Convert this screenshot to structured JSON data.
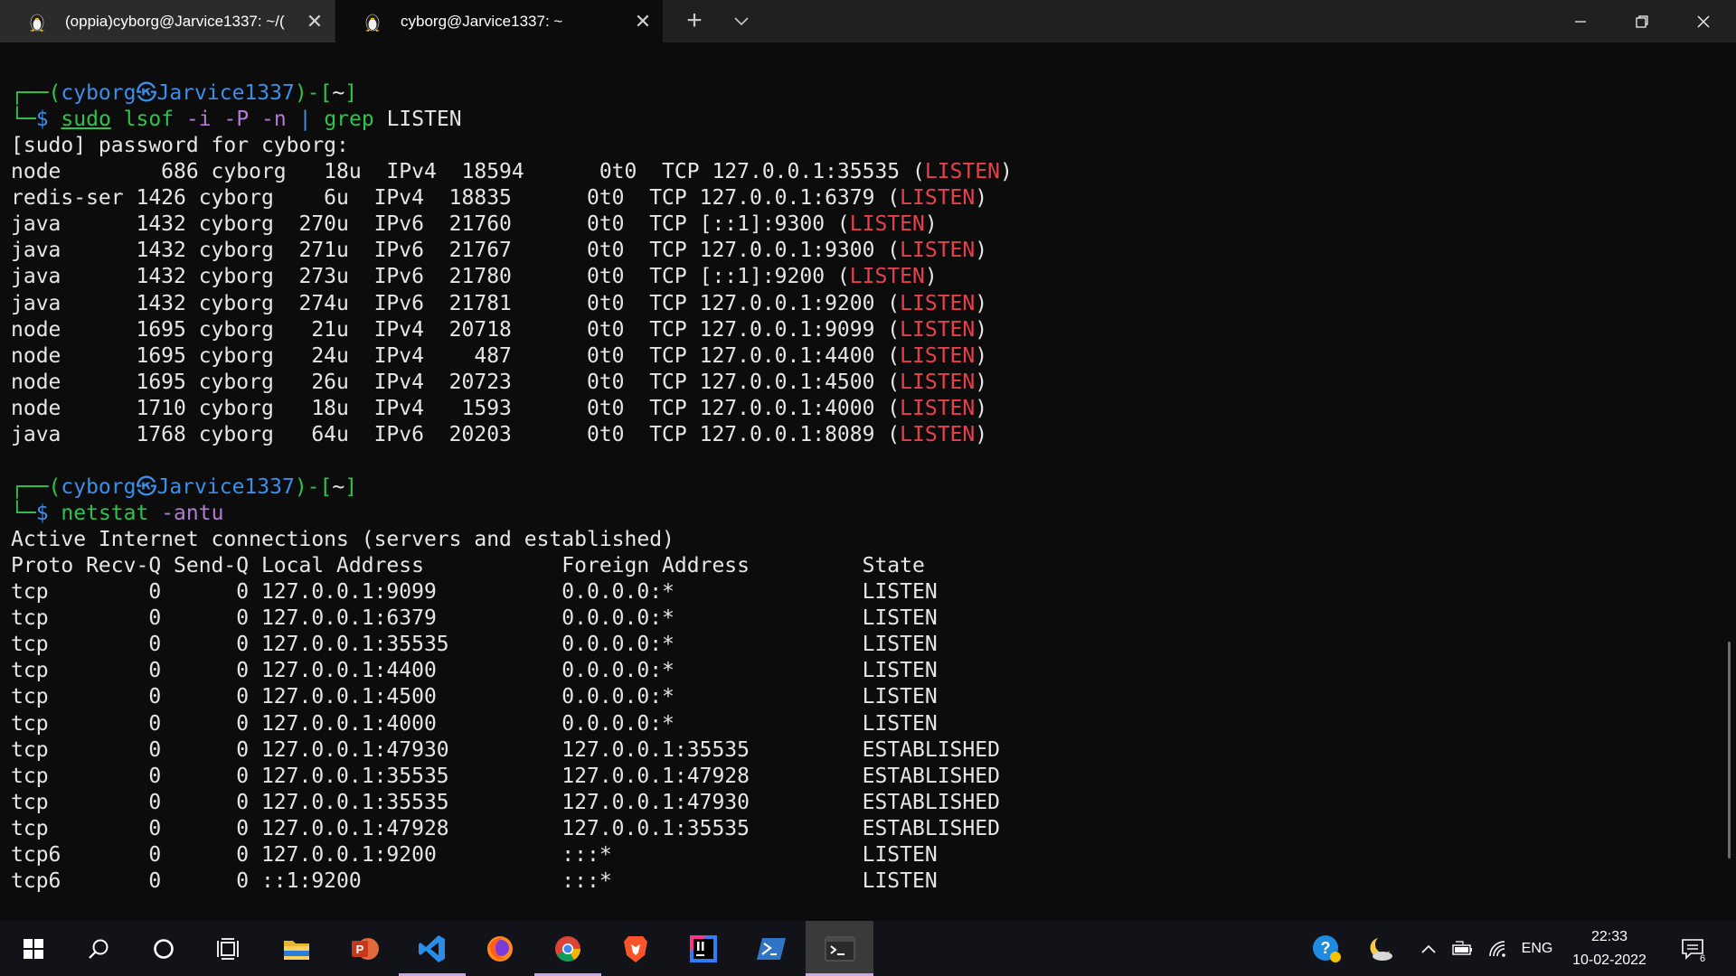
{
  "window": {
    "tabs": [
      {
        "title": "(oppia)cyborg@Jarvice1337: ~/(",
        "icon": "tux-icon",
        "active": false
      },
      {
        "title": "cyborg@Jarvice1337: ~",
        "icon": "tux-icon",
        "active": true
      }
    ],
    "close_glyph": "✕",
    "new_tab_glyph": "+"
  },
  "terminal": {
    "prompt1": {
      "user": "cyborg",
      "at": "㉿",
      "host": "Jarvice1337",
      "dir": "~"
    },
    "command1": {
      "p1": "sudo",
      "p2": "lsof",
      "p3": "-i",
      "p4": "-P",
      "p5": "-n",
      "pipe": "|",
      "p6": "grep",
      "p7": "LISTEN"
    },
    "sudo_prompt": "[sudo] password for cyborg:",
    "lsof_rows": [
      {
        "pre": "node        686 cyborg   18u  IPv4  18594      0t0  TCP 127.0.0.1:35535 (",
        "state": "LISTEN",
        "post": ")"
      },
      {
        "pre": "redis-ser 1426 cyborg    6u  IPv4  18835      0t0  TCP 127.0.0.1:6379 (",
        "state": "LISTEN",
        "post": ")"
      },
      {
        "pre": "java      1432 cyborg  270u  IPv6  21760      0t0  TCP [::1]:9300 (",
        "state": "LISTEN",
        "post": ")"
      },
      {
        "pre": "java      1432 cyborg  271u  IPv6  21767      0t0  TCP 127.0.0.1:9300 (",
        "state": "LISTEN",
        "post": ")"
      },
      {
        "pre": "java      1432 cyborg  273u  IPv6  21780      0t0  TCP [::1]:9200 (",
        "state": "LISTEN",
        "post": ")"
      },
      {
        "pre": "java      1432 cyborg  274u  IPv6  21781      0t0  TCP 127.0.0.1:9200 (",
        "state": "LISTEN",
        "post": ")"
      },
      {
        "pre": "node      1695 cyborg   21u  IPv4  20718      0t0  TCP 127.0.0.1:9099 (",
        "state": "LISTEN",
        "post": ")"
      },
      {
        "pre": "node      1695 cyborg   24u  IPv4    487      0t0  TCP 127.0.0.1:4400 (",
        "state": "LISTEN",
        "post": ")"
      },
      {
        "pre": "node      1695 cyborg   26u  IPv4  20723      0t0  TCP 127.0.0.1:4500 (",
        "state": "LISTEN",
        "post": ")"
      },
      {
        "pre": "node      1710 cyborg   18u  IPv4   1593      0t0  TCP 127.0.0.1:4000 (",
        "state": "LISTEN",
        "post": ")"
      },
      {
        "pre": "java      1768 cyborg   64u  IPv6  20203      0t0  TCP 127.0.0.1:8089 (",
        "state": "LISTEN",
        "post": ")"
      }
    ],
    "prompt2": {
      "user": "cyborg",
      "at": "㉿",
      "host": "Jarvice1337",
      "dir": "~"
    },
    "command2": {
      "p1": "netstat",
      "p2": "-antu"
    },
    "netstat_title": "Active Internet connections (servers and established)",
    "netstat_header": "Proto Recv-Q Send-Q Local Address           Foreign Address         State",
    "netstat_rows": [
      "tcp        0      0 127.0.0.1:9099          0.0.0.0:*               LISTEN",
      "tcp        0      0 127.0.0.1:6379          0.0.0.0:*               LISTEN",
      "tcp        0      0 127.0.0.1:35535         0.0.0.0:*               LISTEN",
      "tcp        0      0 127.0.0.1:4400          0.0.0.0:*               LISTEN",
      "tcp        0      0 127.0.0.1:4500          0.0.0.0:*               LISTEN",
      "tcp        0      0 127.0.0.1:4000          0.0.0.0:*               LISTEN",
      "tcp        0      0 127.0.0.1:47930         127.0.0.1:35535         ESTABLISHED",
      "tcp        0      0 127.0.0.1:35535         127.0.0.1:47928         ESTABLISHED",
      "tcp        0      0 127.0.0.1:35535         127.0.0.1:47930         ESTABLISHED",
      "tcp        0      0 127.0.0.1:47928         127.0.0.1:35535         ESTABLISHED",
      "tcp6       0      0 127.0.0.1:9200          :::*                    LISTEN",
      "tcp6       0      0 ::1:9200                :::*                    LISTEN"
    ]
  },
  "taskbar": {
    "apps": [
      "windows-start-icon",
      "search-icon",
      "cortana-icon",
      "task-view-icon",
      "file-explorer-icon",
      "powerpoint-icon",
      "vscode-icon",
      "firefox-icon",
      "chrome-icon",
      "brave-icon",
      "intellij-icon",
      "powershell-icon",
      "windows-terminal-icon"
    ],
    "tray": {
      "language": "ENG",
      "time": "22:33",
      "date": "10-02-2022",
      "notifications": "6"
    }
  },
  "colors": {
    "prompt_green": "#2ec44c",
    "prompt_blue": "#3b8eea",
    "listen_red": "#e8404b",
    "arg_purple": "#b37ad6"
  }
}
